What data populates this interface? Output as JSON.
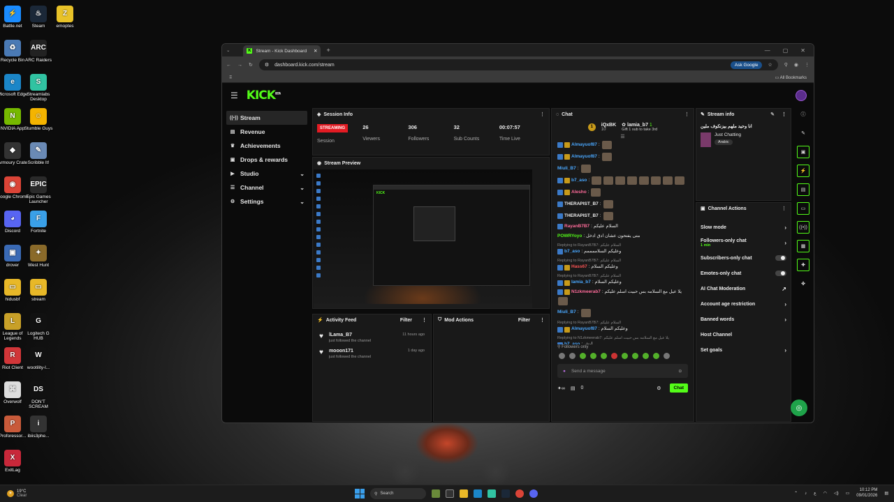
{
  "desktop": {
    "icons": [
      {
        "label": "Battle.net",
        "color": "#1a8cff",
        "glyph": "⚡"
      },
      {
        "label": "Steam",
        "color": "#1b2838",
        "glyph": "♨"
      },
      {
        "label": "emoptes",
        "color": "#e8c228",
        "glyph": "Z"
      },
      {
        "label": "Recycle Bin",
        "color": "#4a7ab5",
        "glyph": "♻"
      },
      {
        "label": "ARC Raiders",
        "color": "#222",
        "glyph": "ARC"
      },
      {
        "label": "Microsoft Edge",
        "color": "#1b86c8",
        "glyph": "e"
      },
      {
        "label": "Streamlabs Desktop",
        "color": "#31c3a2",
        "glyph": "S"
      },
      {
        "label": "NVIDIA App",
        "color": "#76b900",
        "glyph": "N"
      },
      {
        "label": "Stumble Guys",
        "color": "#f4b400",
        "glyph": "☺"
      },
      {
        "label": "Armoury Crate",
        "color": "#333",
        "glyph": "◆"
      },
      {
        "label": "Scribble It!",
        "color": "#6a8ab5",
        "glyph": "✎"
      },
      {
        "label": "Google Chrome",
        "color": "#db4437",
        "glyph": "◉"
      },
      {
        "label": "Epic Games Launcher",
        "color": "#2a2a2a",
        "glyph": "EPIC"
      },
      {
        "label": "Discord",
        "color": "#5865f2",
        "glyph": "◕"
      },
      {
        "label": "Fortnite",
        "color": "#3aa0e8",
        "glyph": "F"
      },
      {
        "label": "drover",
        "color": "#3a6ab5",
        "glyph": "▣"
      },
      {
        "label": "West Hunt",
        "color": "#8a6a2a",
        "glyph": "✦"
      },
      {
        "label": "hidusbf",
        "color": "#e8b828",
        "glyph": "▭"
      },
      {
        "label": "stream",
        "color": "#e8b828",
        "glyph": "▭"
      },
      {
        "label": "League of Legends",
        "color": "#c8a028",
        "glyph": "L"
      },
      {
        "label": "Logitech G HUB",
        "color": "#111",
        "glyph": "G"
      },
      {
        "label": "Riot Client",
        "color": "#d13639",
        "glyph": "R"
      },
      {
        "label": "wootility-l...",
        "color": "#111",
        "glyph": "W"
      },
      {
        "label": "Overwolf",
        "color": "#ddd",
        "glyph": "⌘"
      },
      {
        "label": "DON'T SCREAM",
        "color": "#111",
        "glyph": "DS"
      },
      {
        "label": "Proforessor...",
        "color": "#c85a3a",
        "glyph": "P"
      },
      {
        "label": "ibiis3phe...",
        "color": "#333",
        "glyph": "i"
      },
      {
        "label": "ExitLag",
        "color": "#c8283a",
        "glyph": "X"
      }
    ]
  },
  "browser": {
    "tab_title": "Stream - Kick Dashboard",
    "new_tab": "+",
    "url": "dashboard.kick.com/stream",
    "ask_google": "Ask Google",
    "all_bookmarks": "All Bookmarks"
  },
  "app": {
    "logo": "KICK",
    "logo_sup": "BETA",
    "nav": [
      {
        "label": "Stream",
        "icon": "((•))",
        "active": true,
        "chev": ""
      },
      {
        "label": "Revenue",
        "icon": "▤",
        "active": false,
        "chev": ""
      },
      {
        "label": "Achievements",
        "icon": "♛",
        "active": false,
        "chev": ""
      },
      {
        "label": "Drops & rewards",
        "icon": "▣",
        "active": false,
        "chev": ""
      },
      {
        "label": "Studio",
        "icon": "▶",
        "active": false,
        "chev": "⌄"
      },
      {
        "label": "Channel",
        "icon": "☰",
        "active": false,
        "chev": "⌄"
      },
      {
        "label": "Settings",
        "icon": "⚙",
        "active": false,
        "chev": "⌄"
      }
    ],
    "session": {
      "title": "Session Info",
      "status": "STREAMING",
      "status_label": "Session",
      "stats": [
        {
          "value": "26",
          "label": "Viewers"
        },
        {
          "value": "306",
          "label": "Followers"
        },
        {
          "value": "32",
          "label": "Sub Counts"
        },
        {
          "value": "00:07:57",
          "label": "Time Live"
        }
      ]
    },
    "preview": {
      "title": "Stream Preview",
      "mini_logo": "KICK"
    },
    "activity": {
      "title": "Activity Feed",
      "filter": "Filter",
      "rows": [
        {
          "name": "lLama_B7",
          "sub": "just followed the channel",
          "time": "11 hours ago"
        },
        {
          "name": "mooon171",
          "sub": "just followed the channel",
          "time": "1 day ago"
        }
      ]
    },
    "mod": {
      "title": "Mod Actions",
      "filter": "Filter"
    },
    "chat": {
      "title": "Chat",
      "top_user1": "iQxBK",
      "top_count1": "10",
      "top_user2": "lamia_b7",
      "top_count2": "1",
      "gift": "Gift 1 sub to take 3rd",
      "messages": [
        {
          "reply": "",
          "user": "Almayuof87",
          "cls": "u-blue",
          "text": ":",
          "b": 2,
          "emotes": 1
        },
        {
          "reply": "",
          "user": "Almayuof87",
          "cls": "u-blue",
          "text": ":",
          "b": 2,
          "emotes": 1
        },
        {
          "reply": "",
          "user": "Miuli_B7",
          "cls": "u-blue",
          "text": ":",
          "b": 0,
          "emotes": 1
        },
        {
          "reply": "",
          "user": "b7_aso",
          "cls": "u-blue",
          "text": ":",
          "b": 2,
          "emotes": 8
        },
        {
          "reply": "",
          "user": "Alesho",
          "cls": "u-pink",
          "text": ":",
          "b": 2,
          "emotes": 1
        },
        {
          "reply": "",
          "user": "THERAPIST_B7",
          "cls": "u-white",
          "text": ":",
          "b": 1,
          "emotes": 1
        },
        {
          "reply": "",
          "user": "THERAPIST_B7",
          "cls": "u-white",
          "text": ":",
          "b": 1,
          "emotes": 1
        },
        {
          "reply": "",
          "user": "RayanB7B7",
          "cls": "u-pink",
          "text": ": السلام عليكم",
          "b": 1,
          "emotes": 0
        },
        {
          "reply": "",
          "user": "POWRYoyo",
          "cls": "u-green",
          "text": ": متى يفتحون عشان ادق ادخل",
          "b": 0,
          "emotes": 0
        },
        {
          "reply": "Replying to RayanB7B7: السلام عليكم",
          "user": "b7_aso",
          "cls": "u-blue",
          "text": ": وعليكم السلاممممم",
          "b": 1,
          "emotes": 0
        },
        {
          "reply": "Replying to RayanB7B7: السلام عليكم",
          "user": "Hass67",
          "cls": "u-red",
          "text": ": وعليكم السلام",
          "b": 2,
          "emotes": 0
        },
        {
          "reply": "Replying to RayanB7B7: السلام عليكم",
          "user": "lamia_b7",
          "cls": "u-blue",
          "text": ": وعليكم السلام",
          "b": 2,
          "emotes": 0
        },
        {
          "reply": "",
          "user": "N1zkmeerab7",
          "cls": "u-pink",
          "text": ": يلا عيل مع السلامه بس حبيت اسلم عليكم",
          "b": 2,
          "emotes": 1
        },
        {
          "reply": "",
          "user": "Miuli_B7",
          "cls": "u-blue",
          "text": ":",
          "b": 0,
          "emotes": 1
        },
        {
          "reply": "Replying to RayanB7B7: السلام عليكم",
          "user": "Almayuof87",
          "cls": "u-blue",
          "text": ": وعليكم السلام",
          "b": 2,
          "emotes": 0
        },
        {
          "reply": "Replying to N1zkmeerab7: يلا عيل مع السلامه بس حبيت اسلم عليكم",
          "user": "b7_aso",
          "cls": "u-blue",
          "text": ": ليش",
          "b": 1,
          "emotes": 0
        },
        {
          "reply": "Replying to RayanB7B7: السلام عليكم",
          "user": "Pt_shamr",
          "cls": "u-pink",
          "text": ": وعليكم السلام",
          "b": 1,
          "emotes": 0
        }
      ],
      "followers_only": "Followers only",
      "placeholder": "Send a message",
      "count": "0",
      "send": "Chat"
    },
    "stream_info": {
      "title": "Stream info",
      "stream_title": "انا وحيد ملهم بيزنكوف ملين",
      "category": "Just Chatting",
      "tag": "Arabic"
    },
    "actions": {
      "title": "Channel Actions",
      "items": [
        {
          "label": "Slow mode",
          "sub": "",
          "ctl": "chev"
        },
        {
          "label": "Followers-only chat",
          "sub": "1 min",
          "ctl": "chev"
        },
        {
          "label": "Subscribers-only chat",
          "sub": "",
          "ctl": "toggle"
        },
        {
          "label": "Emotes-only chat",
          "sub": "",
          "ctl": "toggle"
        },
        {
          "label": "AI Chat Moderation",
          "sub": "",
          "ctl": "ext"
        },
        {
          "label": "Account age restriction",
          "sub": "",
          "ctl": "chev"
        },
        {
          "label": "Banned words",
          "sub": "",
          "ctl": "chev"
        },
        {
          "label": "Host Channel",
          "sub": "",
          "ctl": "none"
        },
        {
          "label": "Set goals",
          "sub": "",
          "ctl": "chev"
        }
      ]
    }
  },
  "taskbar": {
    "temp": "19°C",
    "weather": "Clear",
    "search": "Search",
    "time": "10:12 PM",
    "date": "09/01/2026",
    "lang": "ع"
  },
  "colors": {
    "kick_green": "#53fc18",
    "live_red": "#e31b23"
  }
}
